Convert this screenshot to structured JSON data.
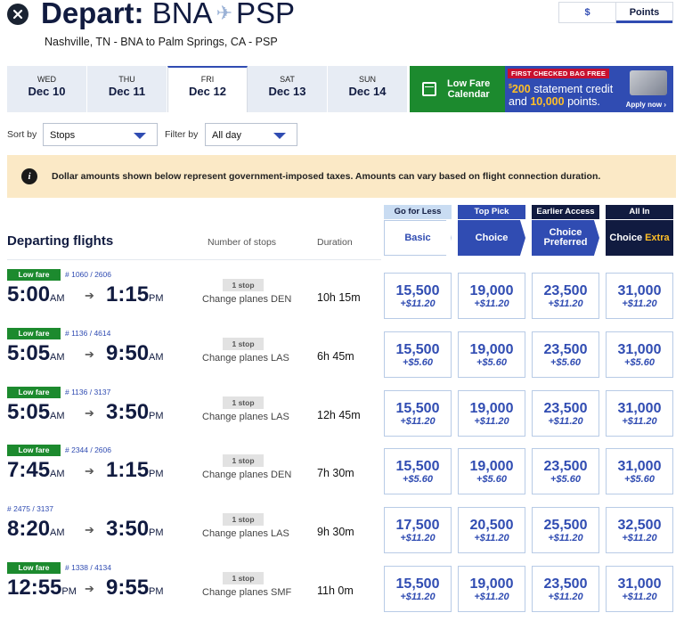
{
  "header": {
    "title_bold": "Depart:",
    "origin": "BNA",
    "destination": "PSP",
    "subtitle": "Nashville, TN - BNA to Palm Springs, CA - PSP"
  },
  "currency_toggle": {
    "dollars": "$",
    "points": "Points",
    "selected": "points"
  },
  "dates": [
    {
      "day": "WED",
      "date": "Dec 10"
    },
    {
      "day": "THU",
      "date": "Dec 11"
    },
    {
      "day": "FRI",
      "date": "Dec 12"
    },
    {
      "day": "SAT",
      "date": "Dec 13"
    },
    {
      "day": "SUN",
      "date": "Dec 14"
    }
  ],
  "low_fare_calendar": {
    "line1": "Low Fare",
    "line2": "Calendar"
  },
  "promo": {
    "banner": "FIRST CHECKED BAG FREE",
    "amount": "200",
    "text1": "statement credit",
    "text2": "and",
    "points": "10,000",
    "text3": "points.",
    "apply": "Apply now"
  },
  "sort": {
    "label": "Sort by",
    "value": "Stops"
  },
  "filter": {
    "label": "Filter by",
    "value": "All day"
  },
  "notice": "Dollar amounts shown below represent government-imposed taxes. Amounts can vary based on flight connection duration.",
  "columns": {
    "departing": "Departing flights",
    "stops": "Number of stops",
    "duration": "Duration"
  },
  "fares": {
    "basic": {
      "tag": "Go for Less",
      "name": "Basic"
    },
    "choice": {
      "tag": "Top Pick",
      "name": "Choice"
    },
    "preferred": {
      "tag": "Earlier Access",
      "name1": "Choice",
      "name2": "Preferred"
    },
    "extra": {
      "tag": "All In",
      "name1": "Choice",
      "name2": "Extra"
    }
  },
  "flights": [
    {
      "low_fare": "Low fare",
      "numbers": "# 1060 / 2606",
      "dep": "5:00",
      "dep_ap": "AM",
      "arr": "1:15",
      "arr_ap": "PM",
      "stop_badge": "1 stop",
      "stop_text": "Change planes DEN",
      "duration": "10h 15m",
      "prices": [
        {
          "pts": "15,500",
          "tax": "+$11.20"
        },
        {
          "pts": "19,000",
          "tax": "+$11.20"
        },
        {
          "pts": "23,500",
          "tax": "+$11.20"
        },
        {
          "pts": "31,000",
          "tax": "+$11.20"
        }
      ]
    },
    {
      "low_fare": "Low fare",
      "numbers": "# 1136 / 4614",
      "dep": "5:05",
      "dep_ap": "AM",
      "arr": "9:50",
      "arr_ap": "AM",
      "stop_badge": "1 stop",
      "stop_text": "Change planes LAS",
      "duration": "6h 45m",
      "prices": [
        {
          "pts": "15,500",
          "tax": "+$5.60"
        },
        {
          "pts": "19,000",
          "tax": "+$5.60"
        },
        {
          "pts": "23,500",
          "tax": "+$5.60"
        },
        {
          "pts": "31,000",
          "tax": "+$5.60"
        }
      ]
    },
    {
      "low_fare": "Low fare",
      "numbers": "# 1136 / 3137",
      "dep": "5:05",
      "dep_ap": "AM",
      "arr": "3:50",
      "arr_ap": "PM",
      "stop_badge": "1 stop",
      "stop_text": "Change planes LAS",
      "duration": "12h 45m",
      "prices": [
        {
          "pts": "15,500",
          "tax": "+$11.20"
        },
        {
          "pts": "19,000",
          "tax": "+$11.20"
        },
        {
          "pts": "23,500",
          "tax": "+$11.20"
        },
        {
          "pts": "31,000",
          "tax": "+$11.20"
        }
      ]
    },
    {
      "low_fare": "Low fare",
      "numbers": "# 2344 / 2606",
      "dep": "7:45",
      "dep_ap": "AM",
      "arr": "1:15",
      "arr_ap": "PM",
      "stop_badge": "1 stop",
      "stop_text": "Change planes DEN",
      "duration": "7h 30m",
      "prices": [
        {
          "pts": "15,500",
          "tax": "+$5.60"
        },
        {
          "pts": "19,000",
          "tax": "+$5.60"
        },
        {
          "pts": "23,500",
          "tax": "+$5.60"
        },
        {
          "pts": "31,000",
          "tax": "+$5.60"
        }
      ]
    },
    {
      "low_fare": "",
      "numbers": "# 2475 / 3137",
      "dep": "8:20",
      "dep_ap": "AM",
      "arr": "3:50",
      "arr_ap": "PM",
      "stop_badge": "1 stop",
      "stop_text": "Change planes LAS",
      "duration": "9h 30m",
      "prices": [
        {
          "pts": "17,500",
          "tax": "+$11.20"
        },
        {
          "pts": "20,500",
          "tax": "+$11.20"
        },
        {
          "pts": "25,500",
          "tax": "+$11.20"
        },
        {
          "pts": "32,500",
          "tax": "+$11.20"
        }
      ]
    },
    {
      "low_fare": "Low fare",
      "numbers": "# 1338 / 4134",
      "dep": "12:55",
      "dep_ap": "PM",
      "arr": "9:55",
      "arr_ap": "PM",
      "stop_badge": "1 stop",
      "stop_text": "Change planes SMF",
      "duration": "11h 0m",
      "prices": [
        {
          "pts": "15,500",
          "tax": "+$11.20"
        },
        {
          "pts": "19,000",
          "tax": "+$11.20"
        },
        {
          "pts": "23,500",
          "tax": "+$11.20"
        },
        {
          "pts": "31,000",
          "tax": "+$11.20"
        }
      ]
    }
  ]
}
